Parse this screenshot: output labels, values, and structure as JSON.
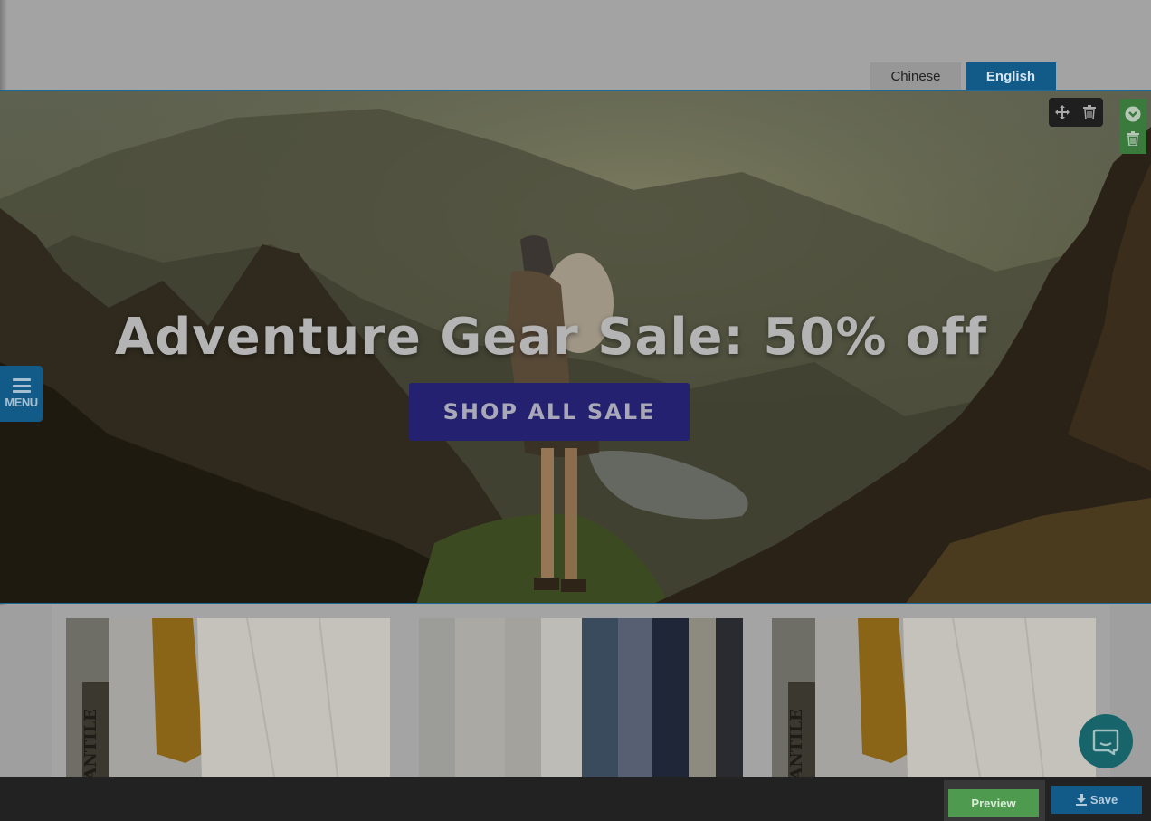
{
  "language_tabs": [
    {
      "label": "Chinese",
      "active": false
    },
    {
      "label": "English",
      "active": true
    }
  ],
  "hero": {
    "title": "Adventure Gear Sale: 50% off",
    "cta_label": "SHOP ALL SALE"
  },
  "block_toolbar": {
    "icons": [
      "move-icon",
      "trash-icon"
    ]
  },
  "section_toolbar": {
    "icons": [
      "chevron-down-circle-icon",
      "trash-icon"
    ]
  },
  "menu": {
    "label": "MENU"
  },
  "products": [
    {
      "image": "shirts-sweater-photo",
      "sign_text": "ANTILE"
    },
    {
      "image": "clothes-rack-photo"
    },
    {
      "image": "shirts-sweater-photo",
      "sign_text": "ANTILE"
    }
  ],
  "chat": {
    "icon": "chat-bubble-icon"
  },
  "bottom_bar": {
    "preview_label": "Preview",
    "save_label": "Save",
    "save_icon": "download-icon"
  },
  "colors": {
    "primary": "#125a87",
    "success": "#4e9a4f",
    "hero_cta": "#232170",
    "dark_bar": "#222222",
    "chat": "#17656b"
  }
}
